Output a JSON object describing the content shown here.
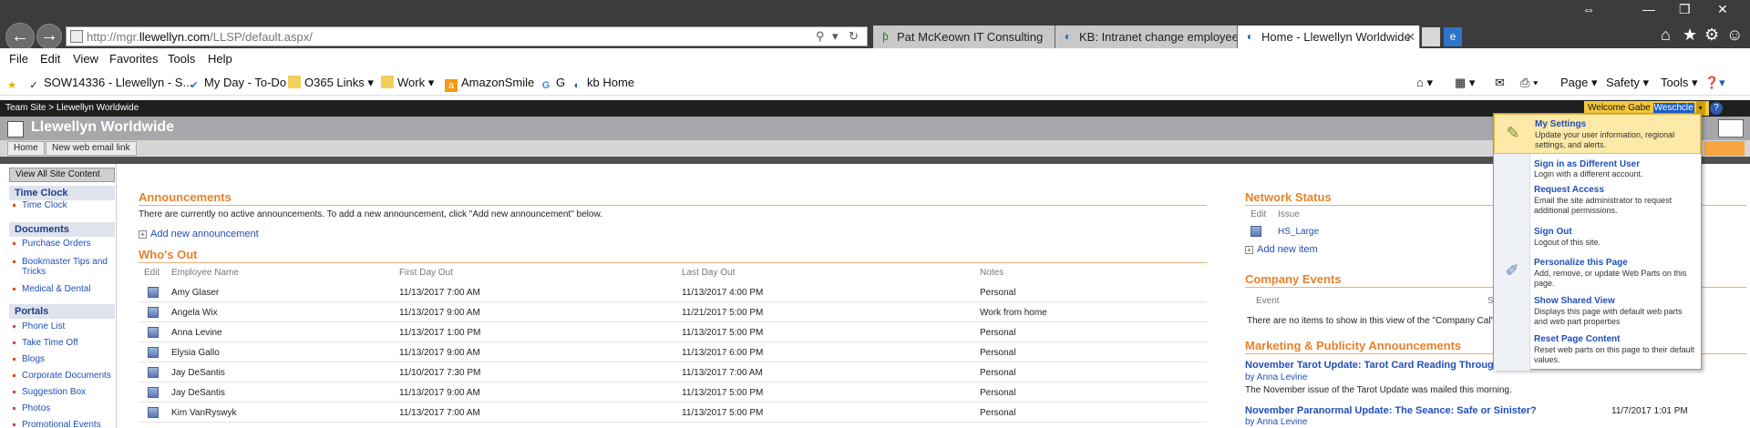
{
  "browser": {
    "url_prefix": "http://mgr.",
    "url_domain": "llewellyn.com",
    "url_path": "/LLSP/default.aspx/",
    "tabs": [
      {
        "label": "Pat McKeown IT Consulting"
      },
      {
        "label": "KB: Intranet change employee ..."
      },
      {
        "label": "Home - Llewellyn Worldwide"
      }
    ],
    "close_glyph": "✕"
  },
  "menu": [
    "File",
    "Edit",
    "View",
    "Favorites",
    "Tools",
    "Help"
  ],
  "favorites": [
    {
      "label": "SOW14336 - Llewellyn - S..."
    },
    {
      "label": "My Day - To-Do"
    },
    {
      "label": "O365 Links ▾"
    },
    {
      "label": "Work ▾"
    },
    {
      "label": "AmazonSmile"
    },
    {
      "label": "G"
    },
    {
      "label": "kb Home"
    }
  ],
  "command_bar": {
    "page": "Page ▾",
    "safety": "Safety ▾",
    "tools": "Tools ▾"
  },
  "sharepoint": {
    "breadcrumb": "Team Site > Llewellyn Worldwide",
    "welcome_prefix": "Welcome Gabe ",
    "welcome_user": "Weschcle",
    "site_title": "Llewellyn Worldwide",
    "nav_tabs": [
      "Home",
      "New web email link"
    ],
    "view_all": "View All Site Content"
  },
  "left_nav": {
    "time_clock_head": "Time Clock",
    "time_clock_items": [
      "Time Clock"
    ],
    "documents_head": "Documents",
    "documents_items": [
      "Purchase Orders",
      "Bookmaster Tips and Tricks",
      "Medical & Dental"
    ],
    "portals_head": "Portals",
    "portals_items": [
      "Phone List",
      "Take Time Off",
      "Blogs",
      "Corporate Documents",
      "Suggestion Box",
      "Photos",
      "Promotional Events"
    ]
  },
  "announcements": {
    "title": "Announcements",
    "empty_text": "There are currently no active announcements. To add a new announcement, click \"Add new announcement\" below.",
    "add_label": "Add new announcement"
  },
  "whos_out": {
    "title": "Who's Out",
    "headers": [
      "Edit",
      "Employee Name",
      "First Day Out",
      "Last Day Out",
      "Notes"
    ],
    "rows": [
      {
        "name": "Amy Glaser",
        "first": "11/13/2017 7:00 AM",
        "last": "11/13/2017 4:00 PM",
        "notes": "Personal"
      },
      {
        "name": "Angela Wix",
        "first": "11/13/2017 9:00 AM",
        "last": "11/21/2017 5:00 PM",
        "notes": "Work from home"
      },
      {
        "name": "Anna Levine",
        "first": "11/13/2017 1:00 PM",
        "last": "11/13/2017 5:00 PM",
        "notes": "Personal"
      },
      {
        "name": "Elysia Gallo",
        "first": "11/13/2017 9:00 AM",
        "last": "11/13/2017 6:00 PM",
        "notes": "Personal"
      },
      {
        "name": "Jay DeSantis",
        "first": "11/10/2017 7:30 PM",
        "last": "11/13/2017 7:00 AM",
        "notes": "Personal"
      },
      {
        "name": "Jay DeSantis",
        "first": "11/13/2017 9:00 AM",
        "last": "11/13/2017 5:00 PM",
        "notes": "Personal"
      },
      {
        "name": "Kim VanRyswyk",
        "first": "11/13/2017 7:00 AM",
        "last": "11/13/2017 5:00 PM",
        "notes": "Personal"
      }
    ]
  },
  "network_status": {
    "title": "Network Status",
    "headers": [
      "Edit",
      "Issue"
    ],
    "item": "HS_Large",
    "add_label": "Add new item"
  },
  "company_events": {
    "title": "Company Events",
    "header": "Event",
    "header_s": "S",
    "empty_text": "There are no items to show in this view of the \"Company Cal\" li"
  },
  "marketing": {
    "title": "Marketing & Publicity Announcements",
    "item1_title": "November Tarot Update: Tarot Card Reading Through",
    "item1_by": "by Anna Levine",
    "item1_desc": "The November issue of the Tarot Update was mailed this morning.",
    "item2_title": "November Paranormal Update: The Seance: Safe or Sinister?",
    "item2_date": "11/7/2017 1:01 PM",
    "item2_by": "by Anna Levine"
  },
  "user_menu": [
    {
      "title": "My Settings",
      "desc": "Update your user information, regional settings, and alerts."
    },
    {
      "title": "Sign in as Different User",
      "desc": "Login with a different account."
    },
    {
      "title": "Request Access",
      "desc": "Email the site administrator to request additional permissions."
    },
    {
      "title": "Sign Out",
      "desc": "Logout of this site."
    },
    {
      "title": "Personalize this Page",
      "desc": "Add, remove, or update Web Parts on this page."
    },
    {
      "title": "Show Shared View",
      "desc": "Displays this page with default web parts and web part properties"
    },
    {
      "title": "Reset Page Content",
      "desc": "Reset web parts on this page to their default values."
    }
  ],
  "icons": [
    "back-arrow-icon",
    "forward-arrow-icon",
    "search-icon",
    "refresh-icon",
    "home-icon",
    "star-icon",
    "gear-icon",
    "smiley-icon",
    "help-icon",
    "rss-icon",
    "print-icon"
  ]
}
